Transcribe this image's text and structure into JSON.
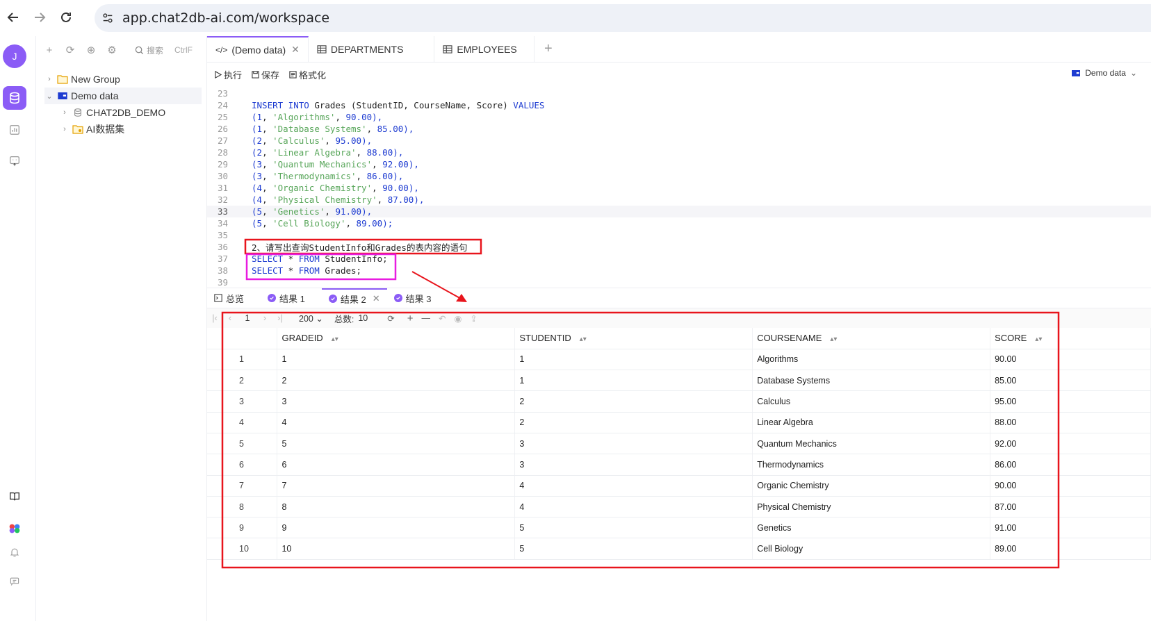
{
  "browser": {
    "url": "app.chat2db-ai.com/workspace"
  },
  "sidebar": {
    "avatar_letter": "J"
  },
  "tree": {
    "search_label": "搜索",
    "search_shortcut": "CtrlF",
    "items": [
      {
        "label": "New Group"
      },
      {
        "label": "Demo data"
      },
      {
        "label": "CHAT2DB_DEMO"
      },
      {
        "label": "AI数据集"
      }
    ]
  },
  "tabs": [
    {
      "label": "(Demo data)"
    },
    {
      "label": "DEPARTMENTS"
    },
    {
      "label": "EMPLOYEES"
    }
  ],
  "editor_toolbar": {
    "run": "执行",
    "save": "保存",
    "format": "格式化",
    "connection": "Demo data"
  },
  "code_lines": [
    {
      "n": "23"
    },
    {
      "n": "24"
    },
    {
      "n": "25"
    },
    {
      "n": "26"
    },
    {
      "n": "27"
    },
    {
      "n": "28"
    },
    {
      "n": "29"
    },
    {
      "n": "30"
    },
    {
      "n": "31"
    },
    {
      "n": "32"
    },
    {
      "n": "33"
    },
    {
      "n": "34"
    },
    {
      "n": "35"
    },
    {
      "n": "36"
    },
    {
      "n": "37"
    },
    {
      "n": "38"
    },
    {
      "n": "39"
    }
  ],
  "code": {
    "insert_kw": "INSERT INTO",
    "insert_rest": " Grades (StudentID, CourseName, Score) ",
    "values_kw": "VALUES",
    "rows": [
      {
        "id": "1",
        "name": "'Algorithms'",
        "score": "90.00",
        "end": "),"
      },
      {
        "id": "1",
        "name": "'Database Systems'",
        "score": "85.00",
        "end": "),"
      },
      {
        "id": "2",
        "name": "'Calculus'",
        "score": "95.00",
        "end": "),"
      },
      {
        "id": "2",
        "name": "'Linear Algebra'",
        "score": "88.00",
        "end": "),"
      },
      {
        "id": "3",
        "name": "'Quantum Mechanics'",
        "score": "92.00",
        "end": "),"
      },
      {
        "id": "3",
        "name": "'Thermodynamics'",
        "score": "86.00",
        "end": "),"
      },
      {
        "id": "4",
        "name": "'Organic Chemistry'",
        "score": "90.00",
        "end": "),"
      },
      {
        "id": "4",
        "name": "'Physical Chemistry'",
        "score": "87.00",
        "end": "),"
      },
      {
        "id": "5",
        "name": "'Genetics'",
        "score": "91.00",
        "end": "),"
      },
      {
        "id": "5",
        "name": "'Cell Biology'",
        "score": "89.00",
        "end": ");"
      }
    ],
    "comment": "2、请写出查询StudentInfo和Grades的表内容的语句",
    "select1_kw": "SELECT",
    "select1_star": " * ",
    "select1_from": "FROM",
    "select1_tbl": " StudentInfo;",
    "select2_kw": "SELECT",
    "select2_star": " * ",
    "select2_from": "FROM",
    "select2_tbl": " Grades;"
  },
  "result_tabs": [
    {
      "label": "总览"
    },
    {
      "label": "结果 1"
    },
    {
      "label": "结果 2"
    },
    {
      "label": "结果 3"
    }
  ],
  "pager": {
    "page": "1",
    "page_size": "200",
    "total_label": "总数:",
    "total": "10"
  },
  "table": {
    "columns": [
      "GRADEID",
      "STUDENTID",
      "COURSENAME",
      "SCORE"
    ],
    "rows": [
      [
        "1",
        "1",
        "1",
        "Algorithms",
        "90.00"
      ],
      [
        "2",
        "2",
        "1",
        "Database Systems",
        "85.00"
      ],
      [
        "3",
        "3",
        "2",
        "Calculus",
        "95.00"
      ],
      [
        "4",
        "4",
        "2",
        "Linear Algebra",
        "88.00"
      ],
      [
        "5",
        "5",
        "3",
        "Quantum Mechanics",
        "92.00"
      ],
      [
        "6",
        "6",
        "3",
        "Thermodynamics",
        "86.00"
      ],
      [
        "7",
        "7",
        "4",
        "Organic Chemistry",
        "90.00"
      ],
      [
        "8",
        "8",
        "4",
        "Physical Chemistry",
        "87.00"
      ],
      [
        "9",
        "9",
        "5",
        "Genetics",
        "91.00"
      ],
      [
        "10",
        "10",
        "5",
        "Cell Biology",
        "89.00"
      ]
    ]
  },
  "colors": {
    "accent": "#8b5cf6",
    "annotation_red": "#e8141c",
    "annotation_magenta": "#e81ce0"
  }
}
